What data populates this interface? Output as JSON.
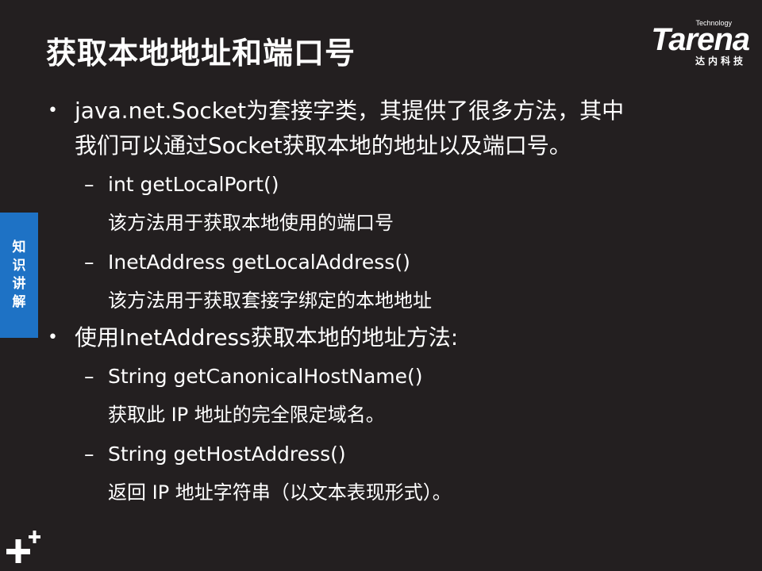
{
  "slide": {
    "title": "获取本地地址和端口号",
    "side_tab": [
      "知",
      "识",
      "讲",
      "解"
    ],
    "logo": {
      "small_word": "Technology",
      "brand": "Tarena",
      "cn": "达内科技"
    },
    "bullets": [
      {
        "text_line1": "java.net.Socket为套接字类，其提供了很多方法，其中",
        "text_line2": "我们可以通过Socket获取本地的地址以及端口号。",
        "subs": [
          {
            "method": "int getLocalPort()",
            "desc": "该方法用于获取本地使用的端口号"
          },
          {
            "method": "InetAddress getLocalAddress()",
            "desc": "该方法用于获取套接字绑定的本地地址"
          }
        ]
      },
      {
        "text_line1": "使用InetAddress获取本地的地址方法:",
        "subs": [
          {
            "method": "String getCanonicalHostName()",
            "desc": "获取此 IP 地址的完全限定域名。"
          },
          {
            "method": "String getHostAddress()",
            "desc": "返回 IP 地址字符串（以文本表现形式）。"
          }
        ]
      }
    ],
    "bullet_glyph": "•",
    "dash_glyph": "–",
    "colors": {
      "background": "#231f20",
      "text": "#ffffff",
      "side_tab": "#1e72c5"
    }
  }
}
